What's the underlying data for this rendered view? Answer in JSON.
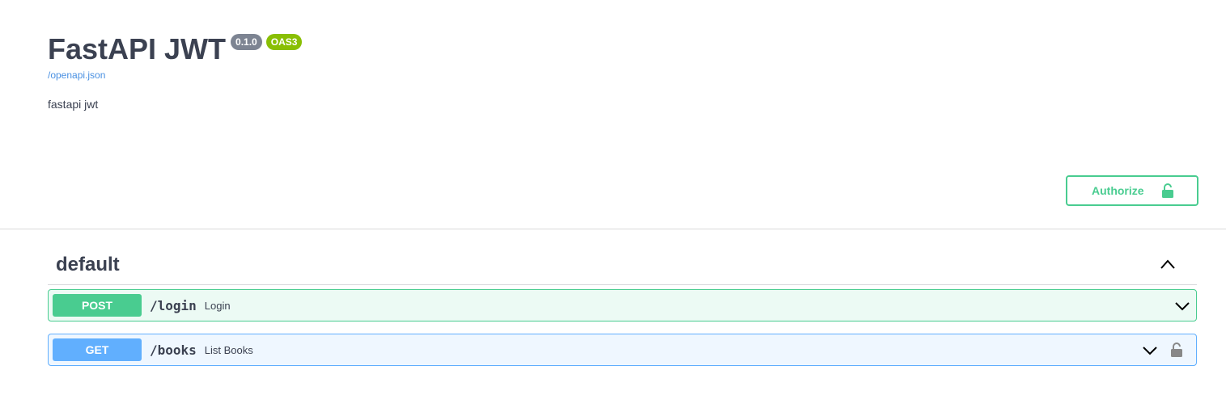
{
  "info": {
    "title": "FastAPI JWT",
    "version_badge": "0.1.0",
    "oas_badge": "OAS3",
    "spec_link": "/openapi.json",
    "description": "fastapi jwt"
  },
  "authorize": {
    "label": "Authorize",
    "icon": "unlocked-lock-icon",
    "color": "#49cc90"
  },
  "section": {
    "title": "default",
    "expanded": true,
    "operations": [
      {
        "method": "POST",
        "path": "/login",
        "summary": "Login",
        "color": "#49cc90",
        "expanded": false
      },
      {
        "method": "GET",
        "path": "/books",
        "summary": "List Books",
        "color": "#61affe",
        "expanded": false,
        "locked": true
      }
    ]
  },
  "colors": {
    "text": "#3b4151",
    "link": "#4990e2",
    "version_badge": "#7d8492",
    "oas_badge": "#89bf04"
  }
}
